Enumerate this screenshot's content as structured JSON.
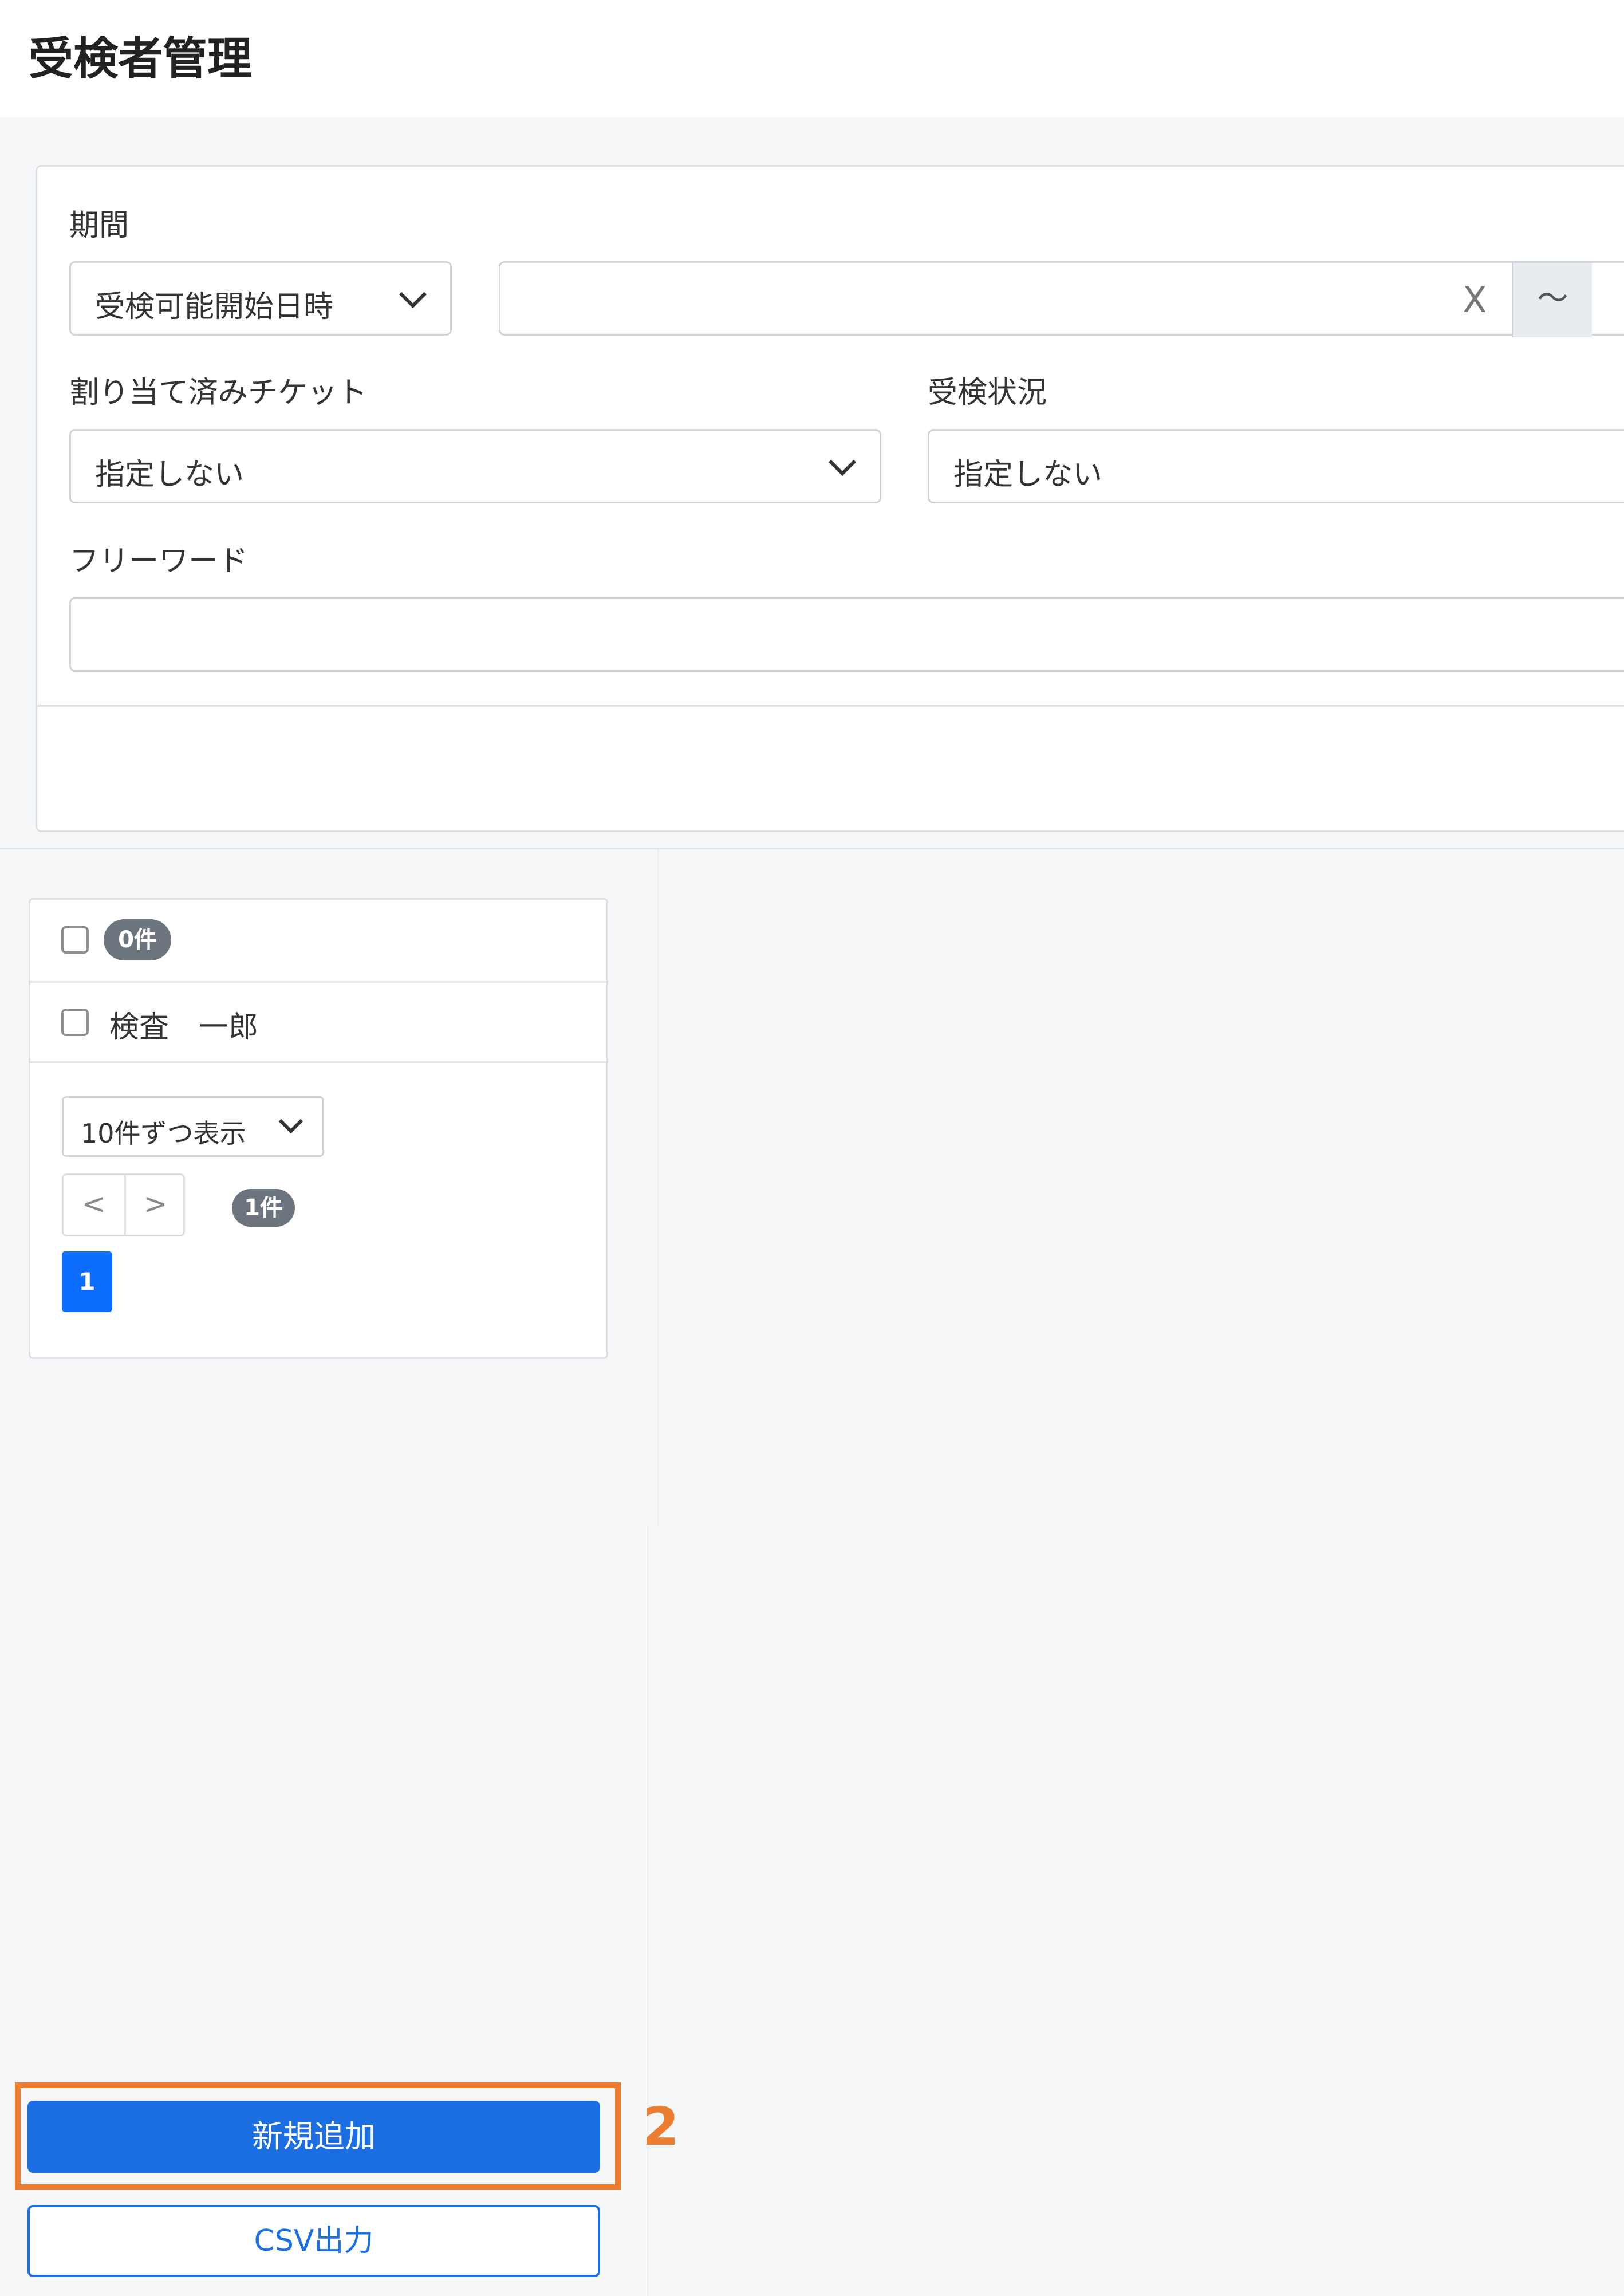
{
  "header": {
    "title": "受検者管理"
  },
  "filters": {
    "period": {
      "label": "期間",
      "type_select": "受検可能開始日時",
      "clear_icon": "X",
      "range_separator": "〜"
    },
    "ticket": {
      "label": "割り当て済みチケット",
      "value": "指定しない"
    },
    "status": {
      "label": "受検状況",
      "value": "指定しない"
    },
    "freeword": {
      "label": "フリーワード",
      "value": ""
    }
  },
  "list": {
    "selected_count": "0件",
    "rows": [
      {
        "name": "検査　一郎"
      }
    ],
    "per_page": "10件ずつ表示",
    "pager_prev": "<",
    "pager_next": ">",
    "total_count": "1件",
    "current_page": "1"
  },
  "actions": {
    "add_new": "新規追加",
    "csv_export": "CSV出力",
    "step_marker": "2"
  },
  "colors": {
    "primary": "#1b6fe3",
    "highlight": "#ed7d31",
    "badge": "#6c757d"
  }
}
